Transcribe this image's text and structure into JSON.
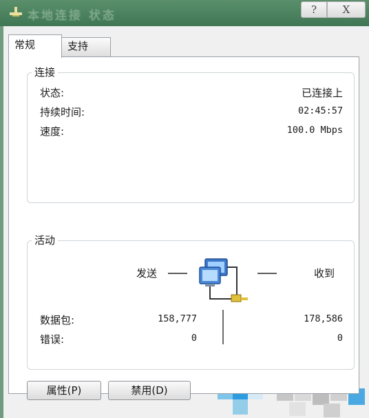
{
  "window": {
    "title": "本地连接 状态",
    "help_label": "?",
    "close_label": "X"
  },
  "tabs": [
    {
      "label": "常规",
      "active": true
    },
    {
      "label": "支持",
      "active": false
    }
  ],
  "connection": {
    "legend": "连接",
    "rows": [
      {
        "label": "状态:",
        "value": "已连接上"
      },
      {
        "label": "持续时间:",
        "value": "02:45:57"
      },
      {
        "label": "速度:",
        "value": "100.0 Mbps"
      }
    ]
  },
  "activity": {
    "legend": "活动",
    "sent_label": "发送",
    "received_label": "收到",
    "packets_label": "数据包:",
    "errors_label": "错误:",
    "packets_sent": "158,777",
    "packets_received": "178,586",
    "errors_sent": "0",
    "errors_received": "0"
  },
  "buttons": {
    "properties": "属性(P)",
    "disable": "禁用(D)"
  },
  "icons": {
    "network": "network-computers-icon",
    "titlebar": "network-connection-icon"
  },
  "colors": {
    "titlebar": "#4a8460",
    "panel": "#ffffff",
    "dialog": "#f0f0f0"
  }
}
